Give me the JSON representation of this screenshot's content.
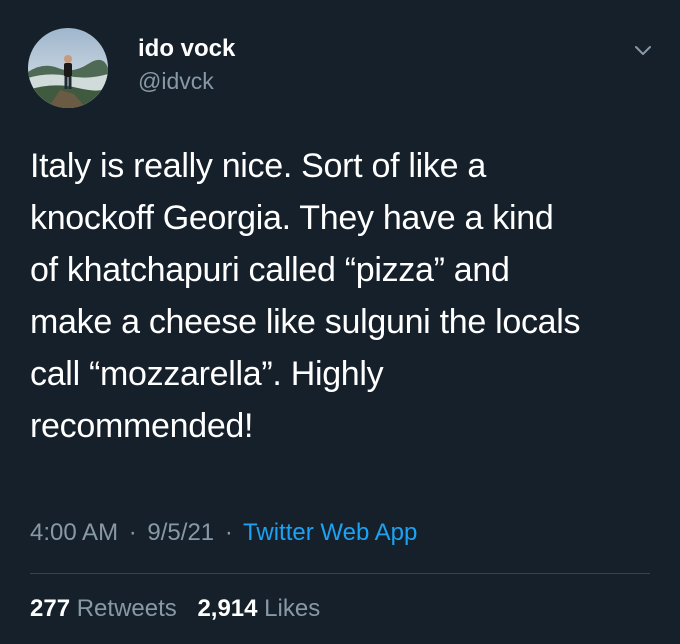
{
  "user": {
    "display_name": "ido vock",
    "handle": "@idvck",
    "avatar": "profile-photo-person-on-mountain"
  },
  "icons": {
    "more_menu": "chevron-down-icon"
  },
  "tweet": {
    "text": "Italy is really nice. Sort of like a\nknockoff Georgia. They have a kind\nof khatchapuri called “pizza” and\nmake a cheese like sulguni the locals\ncall “mozzarella”. Highly\nrecommended!"
  },
  "meta": {
    "time": "4:00 AM",
    "separator": "·",
    "date": "9/5/21",
    "source": "Twitter Web App"
  },
  "stats": {
    "retweets_count": "277",
    "retweets_label": "Retweets",
    "likes_count": "2,914",
    "likes_label": "Likes"
  },
  "colors": {
    "background": "#15202b",
    "primary_text": "#ffffff",
    "secondary_text": "#8899a6",
    "link": "#1da1f2",
    "divider": "#38444d"
  }
}
